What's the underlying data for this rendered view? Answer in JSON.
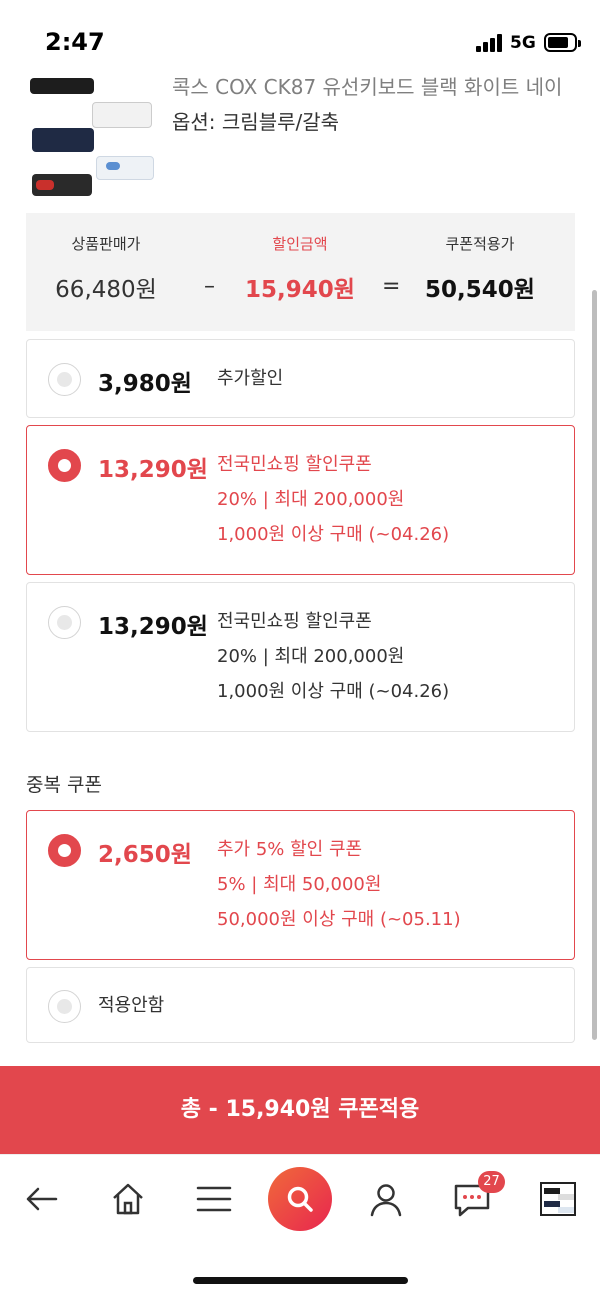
{
  "status_bar": {
    "time": "2:47",
    "network": "5G"
  },
  "product": {
    "name": "콕스 COX CK87 유선키보드 블랙 화이트 네이",
    "option": "옵션: 크림블루/갈축"
  },
  "summary": {
    "price_label": "상품판매가",
    "price_value": "66,480원",
    "minus": "–",
    "discount_label": "할인금액",
    "discount_value": "15,940원",
    "equals": "=",
    "final_label": "쿠폰적용가",
    "final_value": "50,540원"
  },
  "coupons": [
    {
      "amount": "3,980원",
      "name": "추가할인",
      "selected": false
    },
    {
      "amount": "13,290원",
      "name": "전국민쇼핑 할인쿠폰",
      "detail": "20% | 최대 200,000원",
      "condition": "1,000원 이상 구매 (~04.26)",
      "selected": true
    },
    {
      "amount": "13,290원",
      "name": "전국민쇼핑 할인쿠폰",
      "detail": "20% | 최대 200,000원",
      "condition": "1,000원 이상 구매 (~04.26)",
      "selected": false
    }
  ],
  "duplicate_section": {
    "title": "중복 쿠폰",
    "coupons": [
      {
        "amount": "2,650원",
        "name": "추가 5% 할인 쿠폰",
        "detail": "5% | 최대 50,000원",
        "condition": "50,000원 이상 구매 (~05.11)",
        "selected": true
      }
    ],
    "none_label": "적용안함"
  },
  "apply_button": {
    "label": "총 - 15,940원 쿠폰적용"
  },
  "bottom_nav": {
    "chat_badge": "27"
  },
  "colors": {
    "accent": "#e2474d",
    "summary_bg": "#f3f3f3"
  }
}
